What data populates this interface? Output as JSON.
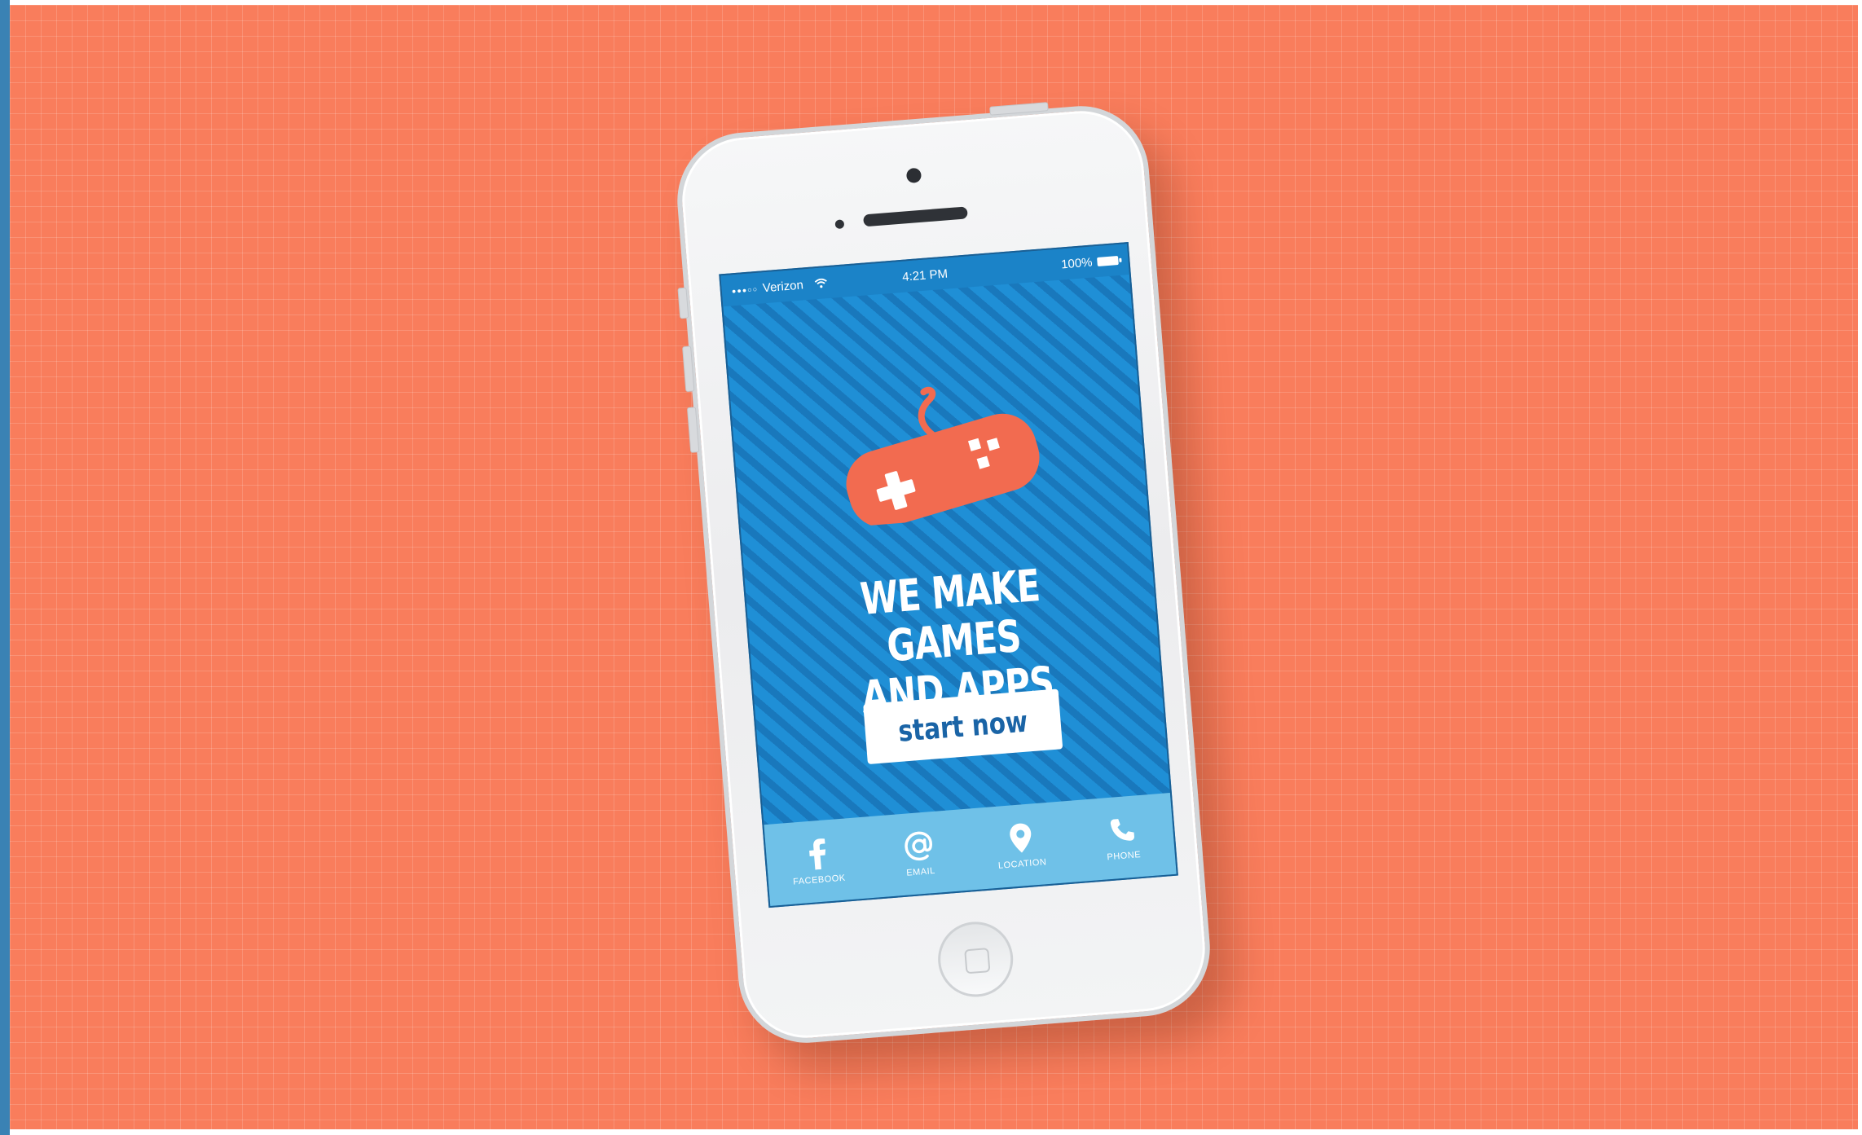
{
  "status_bar": {
    "carrier": "Verizon",
    "signal_dots": "●●●○○",
    "time": "4:21 PM",
    "battery": "100%"
  },
  "hero": {
    "headline_line1": "WE MAKE GAMES",
    "headline_line2": "AND APPS",
    "cta_label": "start now"
  },
  "bottom_nav": [
    {
      "label": "FACEBOOK",
      "icon": "facebook-icon"
    },
    {
      "label": "EMAIL",
      "icon": "at-sign-icon"
    },
    {
      "label": "LOCATION",
      "icon": "map-pin-icon"
    },
    {
      "label": "PHONE",
      "icon": "phone-icon"
    }
  ],
  "colors": {
    "background": "#f97d5c",
    "screen_blue": "#1f8fd6",
    "nav_bar": "#6fc1e8",
    "controller": "#f26b50",
    "button_text": "#1a64a6"
  }
}
